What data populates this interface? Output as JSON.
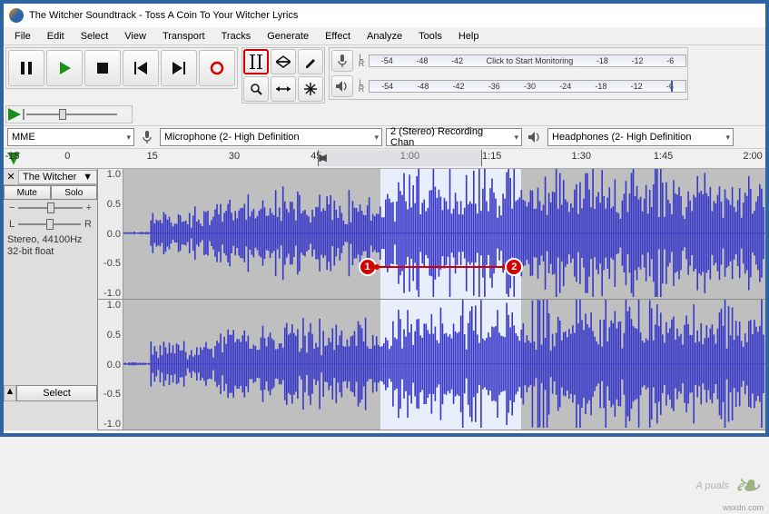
{
  "title": "The Witcher Soundtrack - Toss A Coin To Your Witcher Lyrics",
  "menu": [
    "File",
    "Edit",
    "Select",
    "View",
    "Transport",
    "Tracks",
    "Generate",
    "Effect",
    "Analyze",
    "Tools",
    "Help"
  ],
  "meters": {
    "rec_ticks": [
      "-54",
      "-48",
      "-42"
    ],
    "rec_msg": "Click to Start Monitoring",
    "rec_ticks2": [
      "-18",
      "-12",
      "-6"
    ],
    "play_ticks": [
      "-54",
      "-48",
      "-42",
      "-36",
      "-30",
      "-24",
      "-18",
      "-12",
      "-6"
    ]
  },
  "devices": {
    "host": "MME",
    "input": "Microphone (2- High Definition",
    "channels": "2 (Stereo) Recording Chan",
    "output": "Headphones (2- High Definition"
  },
  "timeline": {
    "ticks": [
      {
        "label": "-15",
        "pct": -2
      },
      {
        "label": "0",
        "pct": 6
      },
      {
        "label": "15",
        "pct": 17
      },
      {
        "label": "30",
        "pct": 28
      },
      {
        "label": "45",
        "pct": 39
      },
      {
        "label": "1:00",
        "pct": 51
      },
      {
        "label": "1:15",
        "pct": 62
      },
      {
        "label": "1:30",
        "pct": 74
      },
      {
        "label": "1:45",
        "pct": 85
      },
      {
        "label": "2:00",
        "pct": 97
      }
    ],
    "selection": {
      "left_pct": 40,
      "width_pct": 22
    }
  },
  "track": {
    "name": "The Witcher",
    "mute": "Mute",
    "solo": "Solo",
    "info1": "Stereo, 44100Hz",
    "info2": "32-bit float",
    "select_label": "Select",
    "scale": [
      "1.0",
      "0.5",
      "0.0",
      "-0.5",
      "-1.0"
    ]
  },
  "lr": "L\nR",
  "annotations": {
    "a": "1",
    "b": "2"
  },
  "watermark": "A puals",
  "source": "wsxdn.com"
}
